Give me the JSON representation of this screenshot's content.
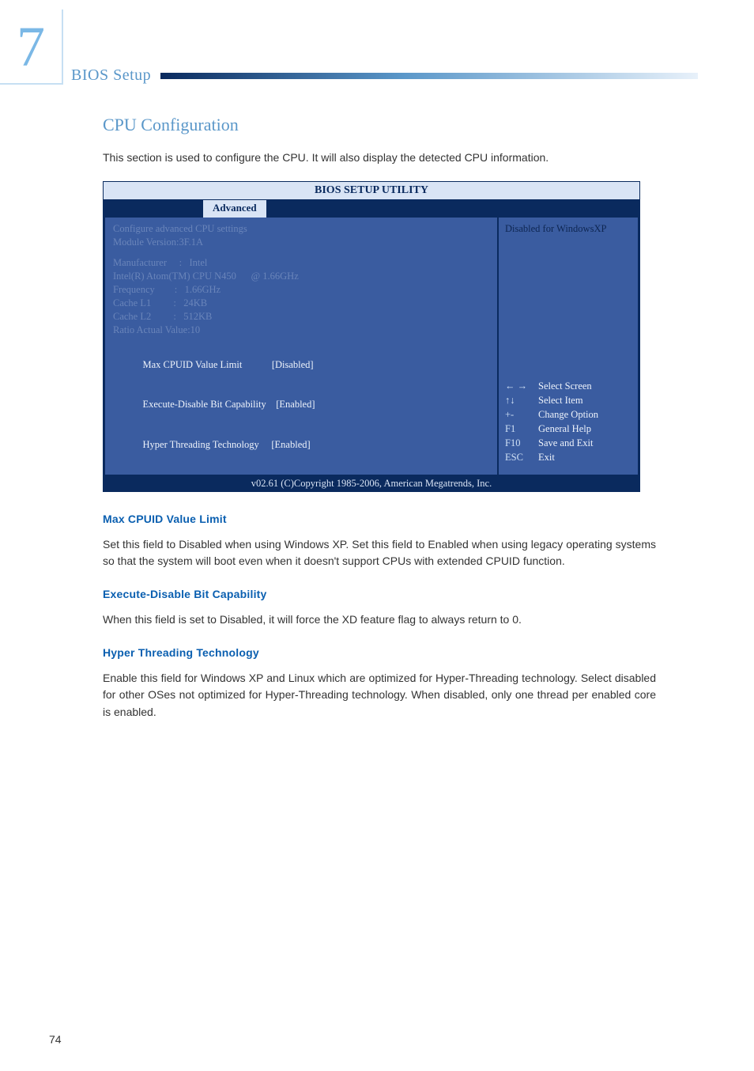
{
  "chapter_number": "7",
  "running_head": "BIOS Setup",
  "heading": "CPU Configuration",
  "intro": "This section is used to configure the CPU. It will also display the detected CPU information.",
  "bios": {
    "title": "BIOS SETUP UTILITY",
    "active_tab": "Advanced",
    "left": {
      "l1": "Configure advanced CPU settings",
      "l2": "Module Version:3F.1A",
      "l3": "Manufacturer     :   Intel",
      "l4": "Intel(R) Atom(TM) CPU N450      @ 1.66GHz",
      "l5": "Frequency        :   1.66GHz",
      "l6": "Cache L1         :   24KB",
      "l7": "Cache L2         :   512KB",
      "l8": "Ratio Actual Value:10",
      "opt1_label": "Max CPUID Value Limit",
      "opt1_value": "[Disabled]",
      "opt2_label": "Execute-Disable Bit Capability",
      "opt2_value": "[Enabled]",
      "opt3_label": "Hyper Threading Technology",
      "opt3_value": "[Enabled]"
    },
    "right": {
      "help": "Disabled for WindowsXP",
      "keys": {
        "k1": "← →",
        "v1": "Select Screen",
        "k2": "↑↓",
        "v2": "Select Item",
        "k3": "+-",
        "v3": "Change Option",
        "k4": "F1",
        "v4": "General Help",
        "k5": "F10",
        "v5": "Save and Exit",
        "k6": "ESC",
        "v6": "Exit"
      }
    },
    "footer": "v02.61 (C)Copyright 1985-2006, American Megatrends, Inc."
  },
  "sections": {
    "s1_title": "Max CPUID Value Limit",
    "s1_body": "Set this field to Disabled when using Windows XP. Set this field to Enabled when using legacy operating systems so that the system will boot even when it doesn't support CPUs with extended CPUID function.",
    "s2_title": "Execute-Disable Bit Capability",
    "s2_body": "When this field is set to Disabled, it will force the XD feature flag to always return to 0.",
    "s3_title": "Hyper Threading Technology",
    "s3_body": "Enable this field for Windows XP and Linux which are optimized for Hyper-Threading technology. Select disabled for other OSes not optimized for Hyper-Threading technology. When disabled, only one thread per enabled core is enabled."
  },
  "page_number": "74"
}
